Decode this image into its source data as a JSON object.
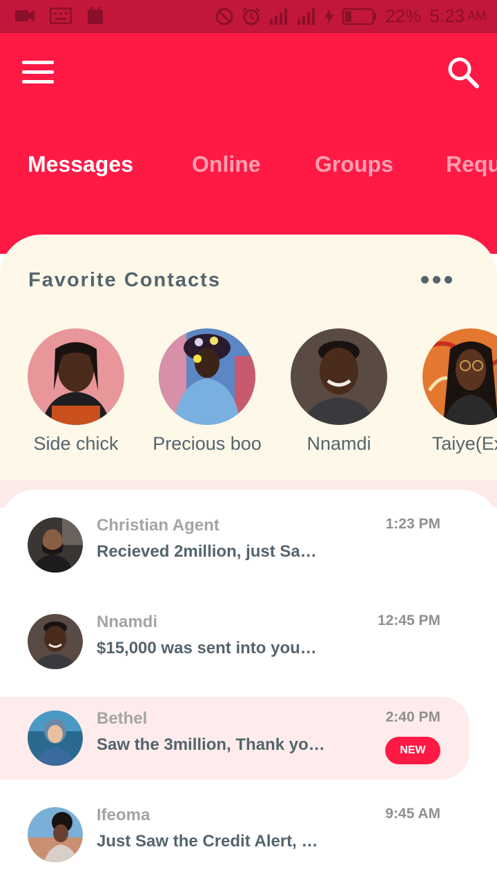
{
  "status_bar": {
    "battery": "22%",
    "time": "5:23",
    "ampm": "AM",
    "icons": [
      "video-icon",
      "keyboard-icon",
      "calendar-icon",
      "do-not-disturb-icon",
      "alarm-icon",
      "signal-icon",
      "signal-icon",
      "charging-icon",
      "battery-icon"
    ]
  },
  "app_bar": {
    "menu_icon": "hamburger-menu-icon",
    "search_icon": "search-icon"
  },
  "tabs": [
    {
      "label": "Messages",
      "active": true
    },
    {
      "label": "Online",
      "active": false
    },
    {
      "label": "Groups",
      "active": false
    },
    {
      "label": "Requ",
      "active": false
    }
  ],
  "favorites": {
    "title": "Favorite Contacts",
    "more_icon": "more-horizontal-icon",
    "contacts": [
      {
        "name": "Side chick"
      },
      {
        "name": "Precious boo"
      },
      {
        "name": "Nnamdi"
      },
      {
        "name": "Taiye(Ex)"
      }
    ]
  },
  "messages": [
    {
      "name": "Christian Agent",
      "text": "Recieved 2million, just Sa…",
      "time": "1:23 PM",
      "unread": false
    },
    {
      "name": "Nnamdi",
      "text": "$15,000 was sent into you…",
      "time": "12:45 PM",
      "unread": false
    },
    {
      "name": "Bethel",
      "text": "Saw the 3million, Thank yo…",
      "time": "2:40 PM",
      "unread": true,
      "badge": "NEW"
    },
    {
      "name": "Ifeoma",
      "text": "Just Saw the Credit Alert, …",
      "time": "9:45 AM",
      "unread": false
    }
  ],
  "colors": {
    "primary": "#fe1a45",
    "status_bar": "#c2173a",
    "favorites_bg": "#fef8e9",
    "highlight_bg": "#feecec",
    "text_dark": "#54646e",
    "text_muted": "#a4a4a4"
  }
}
